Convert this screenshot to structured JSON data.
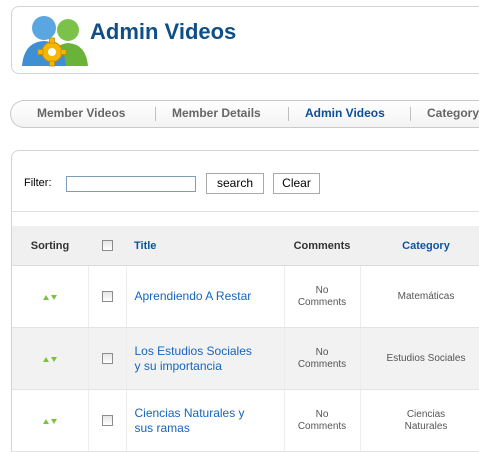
{
  "header": {
    "title": "Admin Videos",
    "icon": "users-gear-icon"
  },
  "submenu": {
    "items": [
      {
        "label": "Member Videos",
        "active": false
      },
      {
        "label": "Member Details",
        "active": false
      },
      {
        "label": "Admin Videos",
        "active": true
      },
      {
        "label": "Category",
        "active": false
      }
    ]
  },
  "filter": {
    "label": "Filter:",
    "value": "",
    "search_label": "search",
    "clear_label": "Clear"
  },
  "table": {
    "columns": [
      "Sorting",
      "",
      "Title",
      "Comments",
      "Category"
    ],
    "rows": [
      {
        "title": [
          "Aprendiendo A Restar"
        ],
        "comments": [
          "No",
          "Comments"
        ],
        "category": [
          "Matemáticas"
        ]
      },
      {
        "title": [
          "Los Estudios Sociales",
          "y su importancia"
        ],
        "comments": [
          "No",
          "Comments"
        ],
        "category": [
          "Estudios Sociales"
        ]
      },
      {
        "title": [
          "Ciencias Naturales y",
          "sus ramas"
        ],
        "comments": [
          "No",
          "Comments"
        ],
        "category": [
          "Ciencias",
          "Naturales"
        ]
      }
    ]
  },
  "colors": {
    "title_blue": "#0f4f86",
    "link_blue": "#1565c0",
    "sort_green": "#7cc241"
  }
}
